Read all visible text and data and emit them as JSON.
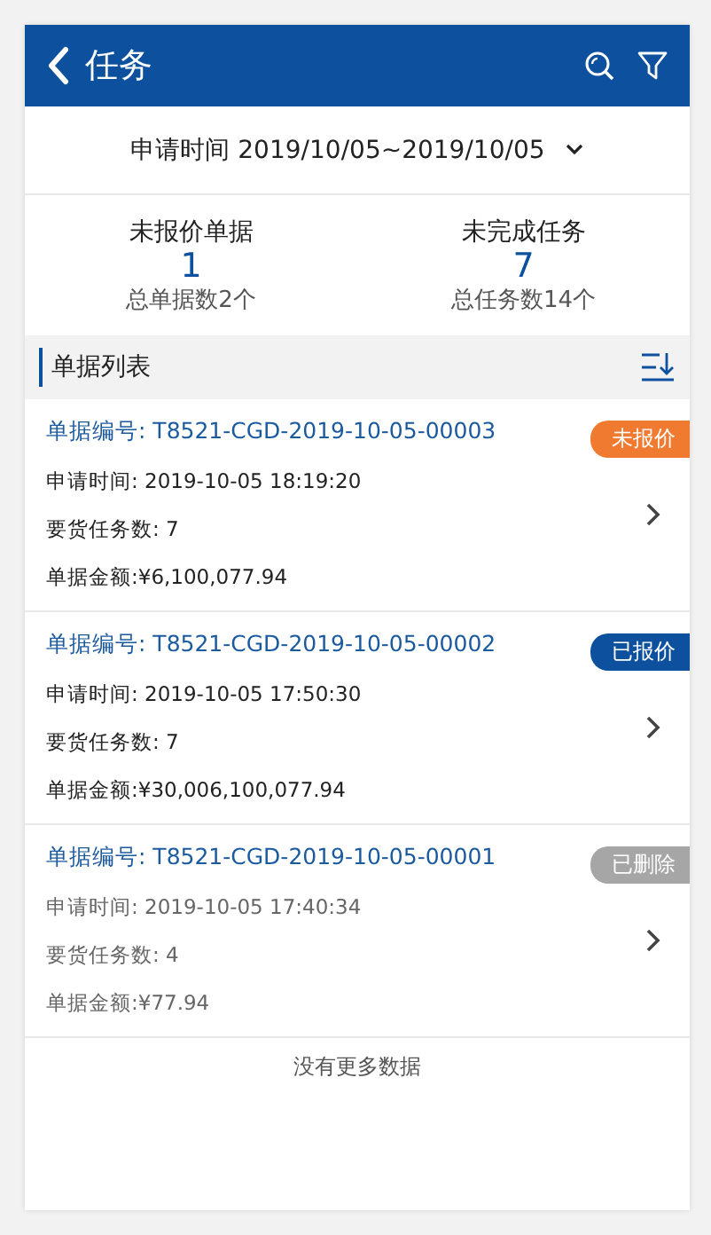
{
  "header": {
    "title": "任务"
  },
  "date_filter": {
    "label": "申请时间 2019/10/05~2019/10/05"
  },
  "stats": [
    {
      "label": "未报价单据",
      "value": "1",
      "total": "总单据数2个"
    },
    {
      "label": "未完成任务",
      "value": "7",
      "total": "总任务数14个"
    }
  ],
  "list": {
    "title": "单据列表"
  },
  "orders": [
    {
      "number": "单据编号: T8521-CGD-2019-10-05-00003",
      "time": "申请时间: 2019-10-05 18:19:20",
      "tasks": "要货任务数: 7",
      "amount": "单据金额:¥6,100,077.94",
      "status": "未报价",
      "kind": "unquoted"
    },
    {
      "number": "单据编号: T8521-CGD-2019-10-05-00002",
      "time": "申请时间: 2019-10-05 17:50:30",
      "tasks": "要货任务数: 7",
      "amount": "单据金额:¥30,006,100,077.94",
      "status": "已报价",
      "kind": "quoted"
    },
    {
      "number": "单据编号: T8521-CGD-2019-10-05-00001",
      "time": "申请时间: 2019-10-05 17:40:34",
      "tasks": "要货任务数: 4",
      "amount": "单据金额:¥77.94",
      "status": "已删除",
      "kind": "deleted"
    }
  ],
  "footer": "没有更多数据"
}
